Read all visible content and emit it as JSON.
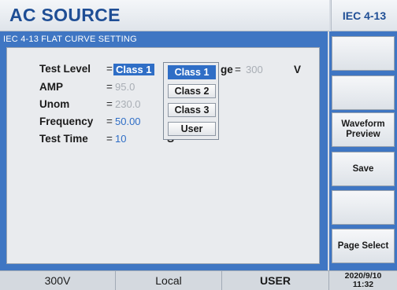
{
  "header": {
    "title": "AC SOURCE",
    "mode": "IEC 4-13"
  },
  "panel": {
    "title": "IEC 4-13 FLAT CURVE SETTING",
    "fields": {
      "test_level": {
        "label": "Test Level",
        "eq": "=",
        "value": "Class 1"
      },
      "voltage": {
        "label_tail": "ge",
        "eq": "=",
        "value": "300",
        "unit": "V"
      },
      "amp": {
        "label": "AMP",
        "eq": "=",
        "value": "95.0"
      },
      "unom": {
        "label": "Unom",
        "eq": "=",
        "value": "230.0"
      },
      "frequency": {
        "label": "Frequency",
        "eq": "=",
        "value": "50.00"
      },
      "test_time": {
        "label": "Test Time",
        "eq": "=",
        "value": "10",
        "unit": "S"
      }
    }
  },
  "dropdown": {
    "options": [
      "Class 1",
      "Class 2",
      "Class 3",
      "User"
    ],
    "selected": "Class 1"
  },
  "softkeys": [
    "",
    "",
    "Waveform\nPreview",
    "Save",
    "",
    "Page Select"
  ],
  "status": {
    "range": "300V",
    "control": "Local",
    "user": "USER",
    "date": "2020/9/10",
    "time": "11:32"
  },
  "colors": {
    "accent": "#3f76c3",
    "title": "#1f4e95",
    "highlight": "#2f6ec6"
  }
}
